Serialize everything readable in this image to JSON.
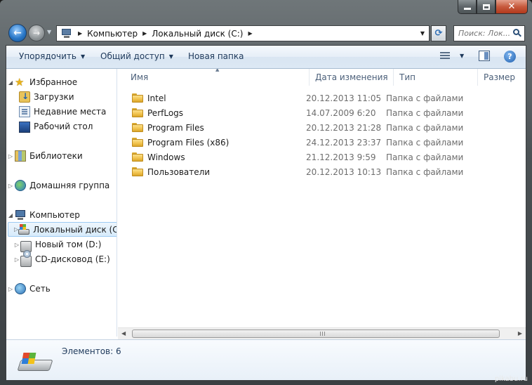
{
  "window": {
    "caption": {
      "minimize": "minimize",
      "maximize": "maximize",
      "close": "close"
    }
  },
  "address": {
    "crumbs": [
      "Компьютер",
      "Локальный диск (C:)"
    ]
  },
  "search": {
    "placeholder": "Поиск: Лок..."
  },
  "toolbar": {
    "organize_label": "Упорядочить",
    "share_label": "Общий доступ",
    "new_folder_label": "Новая папка",
    "help_label": "?"
  },
  "nav": {
    "favorites": "Избранное",
    "downloads": "Загрузки",
    "recent": "Недавние места",
    "desktop": "Рабочий стол",
    "libraries": "Библиотеки",
    "homegroup": "Домашняя группа",
    "computer": "Компьютер",
    "local_disk": "Локальный диск (C:)",
    "new_volume": "Новый том (D:)",
    "cd_drive": "CD-дисковод (E:)",
    "network": "Сеть"
  },
  "columns": {
    "name": "Имя",
    "date": "Дата изменения",
    "type": "Тип",
    "size": "Размер"
  },
  "files": [
    {
      "name": "Intel",
      "date": "20.12.2013 11:05",
      "type": "Папка с файлами"
    },
    {
      "name": "PerfLogs",
      "date": "14.07.2009 6:20",
      "type": "Папка с файлами"
    },
    {
      "name": "Program Files",
      "date": "20.12.2013 21:28",
      "type": "Папка с файлами"
    },
    {
      "name": "Program Files (x86)",
      "date": "24.12.2013 23:37",
      "type": "Папка с файлами"
    },
    {
      "name": "Windows",
      "date": "21.12.2013 9:59",
      "type": "Папка с файлами"
    },
    {
      "name": "Пользователи",
      "date": "20.12.2013 10:13",
      "type": "Папка с файлами"
    }
  ],
  "details": {
    "count_text": "Элементов: 6"
  },
  "watermark": "pikabu.ru",
  "icons": {
    "back": "back-arrow-icon",
    "forward": "forward-arrow-icon",
    "folder": "folder-icon",
    "search": "search-icon"
  },
  "colors": {
    "accent": "#1e395b",
    "selection": "#d7ebfb",
    "folder": "#f0c14b"
  }
}
